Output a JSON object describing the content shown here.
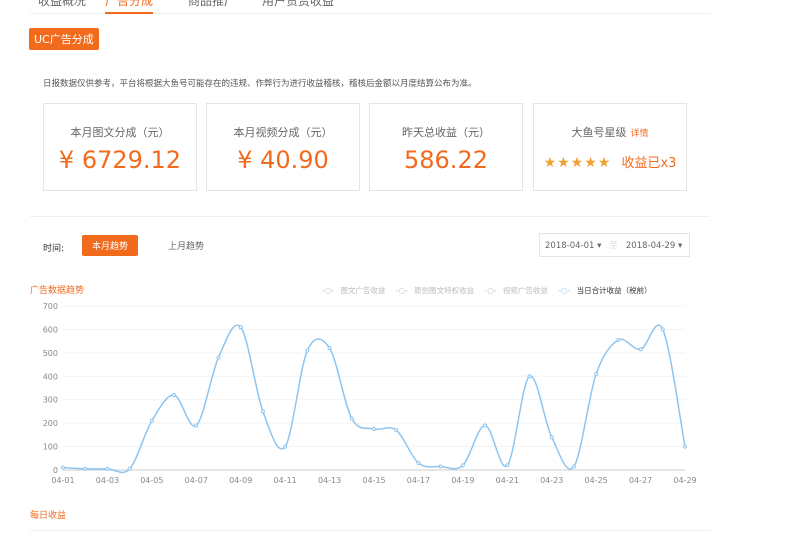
{
  "tabs": [
    "收益概况",
    "广告分成",
    "商品推广",
    "用户赞赏收益"
  ],
  "badge": "UC广告分成",
  "notice": "日报数据仅供参考，平台将根据大鱼号可能存在的违规、作弊行为进行收益稽核，稽核后金额以月度结算公布为准。",
  "cards": [
    {
      "title": "本月图文分成（元）",
      "value": "¥ 6729.12"
    },
    {
      "title": "本月视频分成（元）",
      "value": "¥ 40.90"
    },
    {
      "title": "昨天总收益（元）",
      "value": "586.22"
    },
    {
      "title": "大鱼号星级",
      "link": "详情",
      "stars": "★★★★★",
      "value": "收益已x3",
      "star_count": 5
    }
  ],
  "time_label": "时间:",
  "this_month": "本月趋势",
  "last_month": "上月趋势",
  "date_from": "2018-04-01 ▾",
  "date_sep": "至",
  "date_to": "2018-04-29 ▾",
  "chart_title": "广告数据趋势",
  "daily_title": "每日收益",
  "chart_data": {
    "type": "line",
    "title": "广告数据趋势",
    "legend": [
      "图文广告收益",
      "原创图文特权收益",
      "视频广告收益",
      "当日合计收益（税前）"
    ],
    "legend_marker": "-○-",
    "ylim": [
      0,
      700
    ],
    "yticks": [
      0,
      100,
      200,
      300,
      400,
      500,
      600,
      700
    ],
    "x": [
      "04-01",
      "04-02",
      "04-03",
      "04-04",
      "04-05",
      "04-06",
      "04-07",
      "04-08",
      "04-09",
      "04-10",
      "04-11",
      "04-12",
      "04-13",
      "04-14",
      "04-15",
      "04-16",
      "04-17",
      "04-18",
      "04-19",
      "04-20",
      "04-21",
      "04-22",
      "04-23",
      "04-24",
      "04-25",
      "04-26",
      "04-27",
      "04-28",
      "04-29"
    ],
    "xticks": [
      "04-01",
      "04-03",
      "04-05",
      "04-07",
      "04-09",
      "04-11",
      "04-13",
      "04-15",
      "04-17",
      "04-19",
      "04-21",
      "04-23",
      "04-25",
      "04-27",
      "04-29"
    ],
    "series": [
      {
        "name": "当日合计收益（税前）",
        "color": "#8ec5f0",
        "values": [
          10,
          5,
          5,
          5,
          210,
          320,
          190,
          480,
          610,
          250,
          100,
          510,
          520,
          220,
          175,
          170,
          30,
          15,
          20,
          190,
          20,
          400,
          140,
          15,
          410,
          555,
          515,
          600,
          100
        ]
      }
    ]
  }
}
